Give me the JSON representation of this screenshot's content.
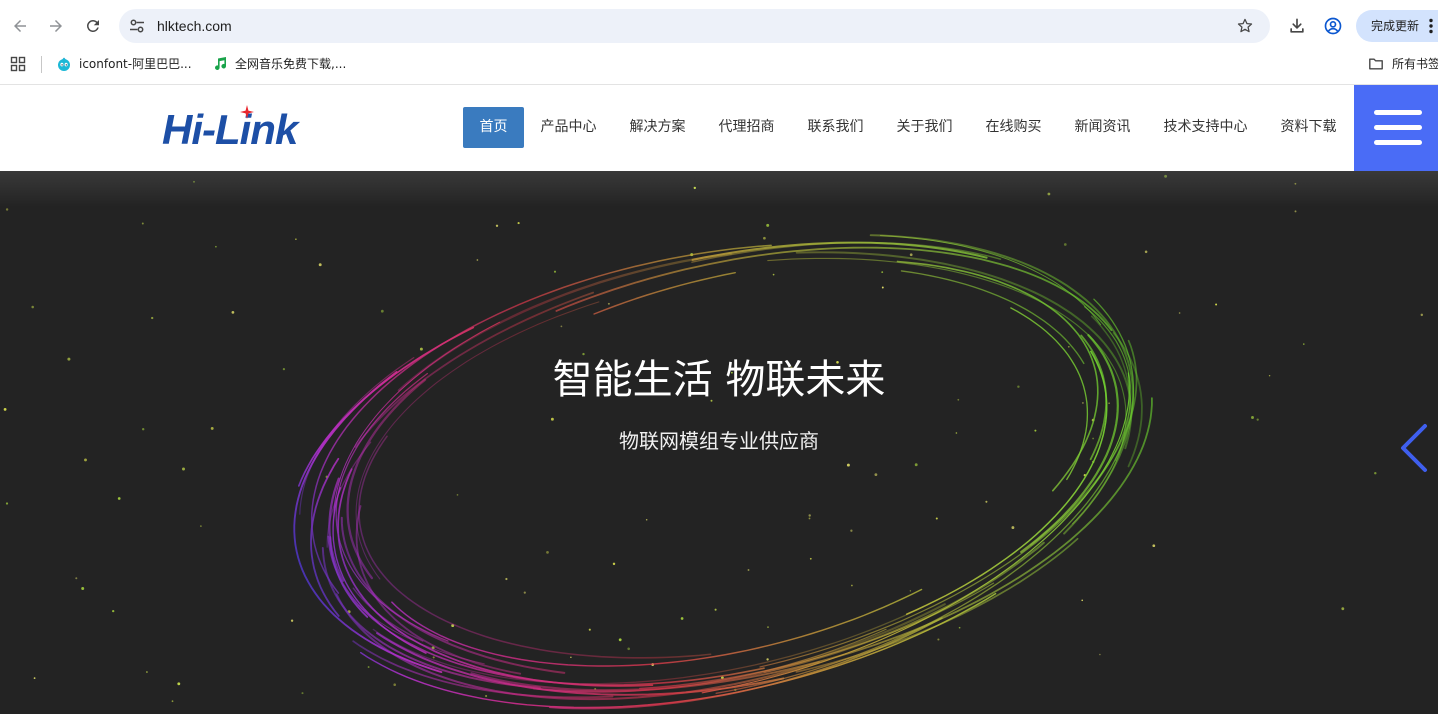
{
  "browser": {
    "address_bar": {
      "url": "hlktech.com"
    },
    "update_button_label": "完成更新",
    "bookmarks": [
      {
        "label": "iconfont-阿里巴巴...",
        "icon": "iconfont-logo-icon"
      },
      {
        "label": "全网音乐免费下载,...",
        "icon": "music-note-icon"
      }
    ],
    "all_bookmarks_label": "所有书签"
  },
  "site": {
    "logo_text": "Hi-Link",
    "nav": [
      "首页",
      "产品中心",
      "解决方案",
      "代理招商",
      "联系我们",
      "关于我们",
      "在线购买",
      "新闻资讯",
      "技术支持中心",
      "资料下载"
    ],
    "active_nav_index": 0
  },
  "hero": {
    "title": "智能生活 物联未来",
    "subtitle": "物联网模组专业供应商"
  },
  "colors": {
    "logo": "#1d4fa6",
    "nav_active_bg": "#3a7bbf",
    "menu_button_bg": "#4a6cf6",
    "carousel_arrow": "#3f5fee",
    "hero_bg": "#232323"
  }
}
